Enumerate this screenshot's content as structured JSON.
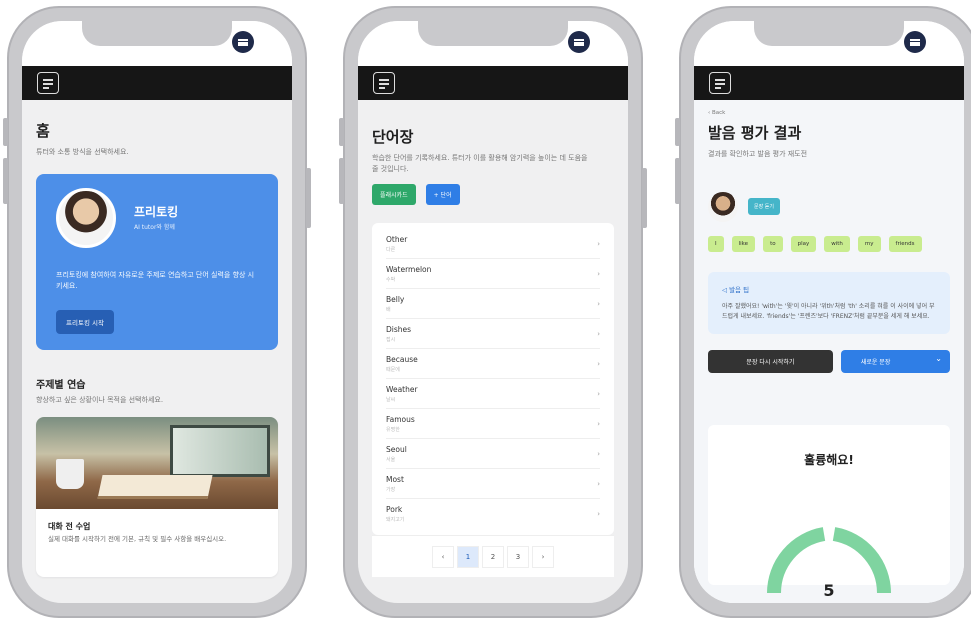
{
  "phone1": {
    "title": "홈",
    "subtitle": "튜터와 소통 방식을 선택하세요.",
    "hero": {
      "name": "프리토킹",
      "role": "AI tutor와 함께",
      "description": "프리토킹에 참여하여 자유로운 주제로 연습하고 단어 실력을 향상 시키세요.",
      "button": "프리토킹 시작"
    },
    "section_title": "주제별 연습",
    "section_subtitle": "향상하고 싶은 상황이나 목적을 선택하세요.",
    "card": {
      "title": "대화 전 수업",
      "description": "실제 대화를 시작하기 전에 기본, 규칙 및 필수 사항을 배우십시오."
    }
  },
  "phone2": {
    "title": "단어장",
    "subtitle": "학습한 단어를 기록하세요. 튜터가 이를 활용해 암기력을 높이는 데 도움을 줄 것입니다.",
    "flashcard_button": "플래시카드",
    "add_button": "+ 단어",
    "words": [
      {
        "word": "Other",
        "meaning": "다른"
      },
      {
        "word": "Watermelon",
        "meaning": "수박"
      },
      {
        "word": "Belly",
        "meaning": "배"
      },
      {
        "word": "Dishes",
        "meaning": "접시"
      },
      {
        "word": "Because",
        "meaning": "때문에"
      },
      {
        "word": "Weather",
        "meaning": "날씨"
      },
      {
        "word": "Famous",
        "meaning": "유명한"
      },
      {
        "word": "Seoul",
        "meaning": "서울"
      },
      {
        "word": "Most",
        "meaning": "가장"
      },
      {
        "word": "Pork",
        "meaning": "돼지고기"
      }
    ],
    "pager": {
      "prev": "‹",
      "pages": [
        "1",
        "2",
        "3"
      ],
      "next": "›",
      "active": "1"
    }
  },
  "phone3": {
    "back": "‹ Back",
    "title": "발음 평가 결과",
    "subtitle": "결과를 확인하고 발음 평가 재도전",
    "listen_button": "문장 듣기",
    "words": [
      "I",
      "like",
      "to",
      "play",
      "with",
      "my",
      "friends"
    ],
    "tip_title": "◁ 발음 팁",
    "tip_body": "아주 잘했어요! 'with'는 '윗'이 아니라 '위th'처럼 'th' 소리를 혀를 이 사이에 넣어 부드럽게 내보세요. 'friends'는 '프렌즈'보다 'FRENZ'처럼 끝부분을 세게 해 보세요.",
    "retry_button": "문장 다시 시작하기",
    "new_button": "새로운 문장",
    "new_dropdown": "⌄",
    "result_title": "훌륭해요!",
    "score": "5"
  },
  "notch_icon": "menu-icon",
  "colors": {
    "hero_blue": "#4d8fe8",
    "green": "#2ea86a",
    "blue": "#2f7ee6",
    "chip_green": "#c9ec8f",
    "score_ring": "#7fd4a0"
  }
}
